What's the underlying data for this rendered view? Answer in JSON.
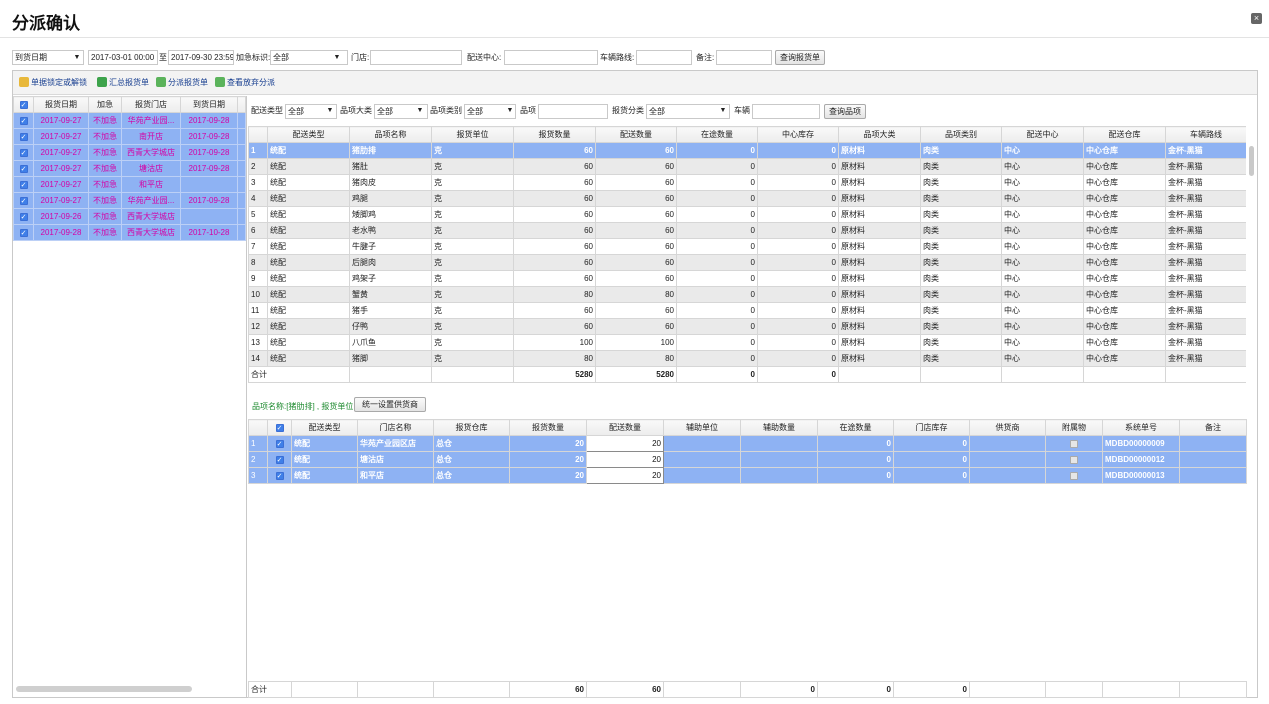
{
  "dialog": {
    "title": "分派确认",
    "close_label": "×"
  },
  "filter": {
    "date_type": "到货日期",
    "date_from": "2017-03-01 00:00",
    "to_label": "至",
    "date_to": "2017-09-30 23:59",
    "urgent_label": "加急标识:",
    "urgent_value": "全部",
    "store_label": "门店:",
    "dc_label": "配送中心:",
    "route_label": "车辆路线:",
    "remark_label": "备注:",
    "query_btn": "查询报货单"
  },
  "toolbar": {
    "lock": "单据锁定或解锁",
    "summary": "汇总报货单",
    "assign": "分派报货单",
    "view_abandon": "查看放弃分派"
  },
  "left_table": {
    "headers": [
      "报货日期",
      "加急",
      "报货门店",
      "到货日期"
    ],
    "rows": [
      [
        "2017-09-27",
        "不加急",
        "华苑产业园...",
        "2017-09-28"
      ],
      [
        "2017-09-27",
        "不加急",
        "南开店",
        "2017-09-28"
      ],
      [
        "2017-09-27",
        "不加急",
        "西青大学城店",
        "2017-09-28"
      ],
      [
        "2017-09-27",
        "不加急",
        "塘沽店",
        "2017-09-28"
      ],
      [
        "2017-09-27",
        "不加急",
        "和平店",
        ""
      ],
      [
        "2017-09-27",
        "不加急",
        "华苑产业园...",
        "2017-09-28"
      ],
      [
        "2017-09-26",
        "不加急",
        "西青大学城店",
        ""
      ],
      [
        "2017-09-28",
        "不加急",
        "西青大学城店",
        "2017-10-28"
      ]
    ]
  },
  "item_filter": {
    "delivery_type_label": "配送类型",
    "delivery_type_value": "全部",
    "category_label": "品项大类",
    "category_value": "全部",
    "subcategory_label": "品项类别",
    "subcategory_value": "全部",
    "item_label": "品项",
    "report_class_label": "报货分类",
    "report_class_value": "全部",
    "vehicle_label": "车辆",
    "query_btn": "查询品项"
  },
  "upper_table": {
    "headers": [
      "配送类型",
      "品项名称",
      "报货单位",
      "报货数量",
      "配送数量",
      "在途数量",
      "中心库存",
      "品项大类",
      "品项类别",
      "配送中心",
      "配送仓库",
      "车辆路线"
    ],
    "rows": [
      [
        "1",
        "统配",
        "猪肋排",
        "克",
        "60",
        "60",
        "0",
        "0",
        "原材料",
        "肉类",
        "中心",
        "中心仓库",
        "金杯-黑猫"
      ],
      [
        "2",
        "统配",
        "猪肚",
        "克",
        "60",
        "60",
        "0",
        "0",
        "原材料",
        "肉类",
        "中心",
        "中心仓库",
        "金杯-黑猫"
      ],
      [
        "3",
        "统配",
        "猪肉皮",
        "克",
        "60",
        "60",
        "0",
        "0",
        "原材料",
        "肉类",
        "中心",
        "中心仓库",
        "金杯-黑猫"
      ],
      [
        "4",
        "统配",
        "鸡腿",
        "克",
        "60",
        "60",
        "0",
        "0",
        "原材料",
        "肉类",
        "中心",
        "中心仓库",
        "金杯-黑猫"
      ],
      [
        "5",
        "统配",
        "矮脚鸡",
        "克",
        "60",
        "60",
        "0",
        "0",
        "原材料",
        "肉类",
        "中心",
        "中心仓库",
        "金杯-黑猫"
      ],
      [
        "6",
        "统配",
        "老水鸭",
        "克",
        "60",
        "60",
        "0",
        "0",
        "原材料",
        "肉类",
        "中心",
        "中心仓库",
        "金杯-黑猫"
      ],
      [
        "7",
        "统配",
        "牛腱子",
        "克",
        "60",
        "60",
        "0",
        "0",
        "原材料",
        "肉类",
        "中心",
        "中心仓库",
        "金杯-黑猫"
      ],
      [
        "8",
        "统配",
        "后腿肉",
        "克",
        "60",
        "60",
        "0",
        "0",
        "原材料",
        "肉类",
        "中心",
        "中心仓库",
        "金杯-黑猫"
      ],
      [
        "9",
        "统配",
        "鸡架子",
        "克",
        "60",
        "60",
        "0",
        "0",
        "原材料",
        "肉类",
        "中心",
        "中心仓库",
        "金杯-黑猫"
      ],
      [
        "10",
        "统配",
        "蟹黄",
        "克",
        "80",
        "80",
        "0",
        "0",
        "原材料",
        "肉类",
        "中心",
        "中心仓库",
        "金杯-黑猫"
      ],
      [
        "11",
        "统配",
        "猪手",
        "克",
        "60",
        "60",
        "0",
        "0",
        "原材料",
        "肉类",
        "中心",
        "中心仓库",
        "金杯-黑猫"
      ],
      [
        "12",
        "统配",
        "仔鸭",
        "克",
        "60",
        "60",
        "0",
        "0",
        "原材料",
        "肉类",
        "中心",
        "中心仓库",
        "金杯-黑猫"
      ],
      [
        "13",
        "统配",
        "八爪鱼",
        "克",
        "100",
        "100",
        "0",
        "0",
        "原材料",
        "肉类",
        "中心",
        "中心仓库",
        "金杯-黑猫"
      ],
      [
        "14",
        "统配",
        "猪脚",
        "克",
        "80",
        "80",
        "0",
        "0",
        "原材料",
        "肉类",
        "中心",
        "中心仓库",
        "金杯-黑猫"
      ]
    ],
    "sum_label": "合计",
    "sum_report_qty": "5280",
    "sum_delivery_qty": "5280",
    "sum_transit": "0",
    "sum_stock": "0"
  },
  "info_line": "品项名称:[猪肋排] , 报货单位:[克]",
  "set_supplier_btn": "统一设置供货商",
  "lower_table": {
    "headers": [
      "配送类型",
      "门店名称",
      "报货仓库",
      "报货数量",
      "配送数量",
      "辅助单位",
      "辅助数量",
      "在途数量",
      "门店库存",
      "供货商",
      "附属物",
      "系统单号",
      "备注"
    ],
    "rows": [
      [
        "1",
        "统配",
        "华苑产业园区店",
        "总仓",
        "20",
        "20",
        "",
        "",
        "0",
        "0",
        "",
        "",
        "MDBD00000009",
        ""
      ],
      [
        "2",
        "统配",
        "塘沽店",
        "总仓",
        "20",
        "20",
        "",
        "",
        "0",
        "0",
        "",
        "",
        "MDBD00000012",
        ""
      ],
      [
        "3",
        "统配",
        "和平店",
        "总仓",
        "20",
        "20",
        "",
        "",
        "0",
        "0",
        "",
        "",
        "MDBD00000013",
        ""
      ]
    ],
    "sum_label": "合计",
    "sum_report_qty": "60",
    "sum_delivery_qty": "60",
    "sum_aux": "0",
    "sum_transit": "0",
    "sum_store_stock": "0"
  },
  "colors": {
    "selected_row": "#8eb2f3",
    "magenta_text": "#d400a6",
    "info_green": "#1c8a2e"
  },
  "icons": [
    "close-icon",
    "lock-icon",
    "summary-icon",
    "assign-icon",
    "view-icon",
    "checkbox-icon",
    "dropdown-arrow-icon"
  ]
}
